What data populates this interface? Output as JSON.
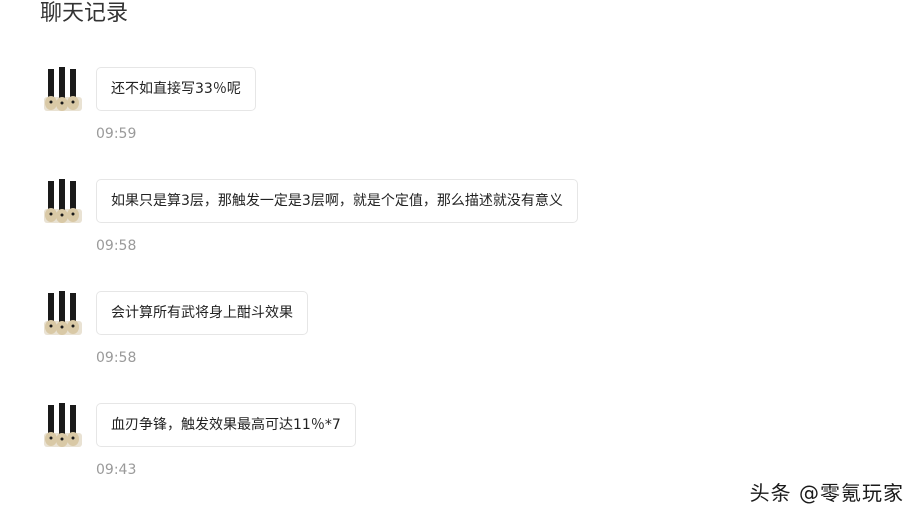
{
  "page": {
    "title": "聊天记录"
  },
  "messages": [
    {
      "text": "还不如直接写33％呢",
      "time": "09:59"
    },
    {
      "text": "如果只是算3层，那触发一定是3层啊，就是个定值，那么描述就没有意义",
      "time": "09:58"
    },
    {
      "text": "会计算所有武将身上酣斗效果",
      "time": "09:58"
    },
    {
      "text": "血刃争锋，触发效果最高可达11％*7",
      "time": "09:43"
    }
  ],
  "watermark": {
    "text": "头条 @零氪玩家"
  },
  "colors": {
    "bubble_border": "#e6e6e6",
    "time_text": "#9a9a9a",
    "avatar_dark": "#1a1a1a",
    "avatar_tan": "#d9c9a6"
  }
}
